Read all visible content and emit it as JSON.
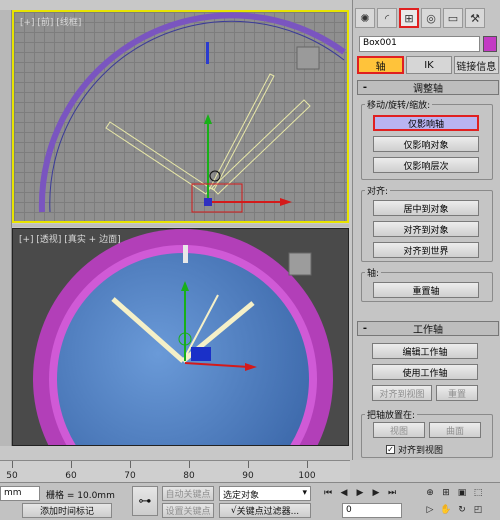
{
  "viewports": {
    "front_label": "[+] [前] [线框]",
    "persp_label": "[+] [透视] [真实 + 边面]"
  },
  "panel": {
    "tab_icons": [
      "sun-icon",
      "curve-icon",
      "hierarchy-icon",
      "motion-icon",
      "display-icon",
      "hammer-icon"
    ],
    "object_name": "Box001",
    "object_color": "#c33bc4",
    "subtabs": {
      "pivot": "轴",
      "ik": "IK",
      "link": "链接信息"
    },
    "adjust_pivot": {
      "title": "调整轴",
      "move_group": "移动/旋转/缩放:",
      "affect_pivot_only": "仅影响轴",
      "affect_object_only": "仅影响对象",
      "affect_hierarchy_only": "仅影响层次",
      "align_group": "对齐:",
      "center_to_object": "居中到对象",
      "align_to_object": "对齐到对象",
      "align_to_world": "对齐到世界",
      "pivot_group": "轴:",
      "reset_pivot": "重置轴"
    },
    "working_pivot": {
      "title": "工作轴",
      "edit": "编辑工作轴",
      "use": "使用工作轴",
      "align_to_view": "对齐到视图",
      "reset": "重置",
      "place_group": "把轴放置在:",
      "view": "视图",
      "surface": "曲面",
      "align_to_view_check": "对齐到视图",
      "check_mark": "✓"
    }
  },
  "ruler": {
    "labels": [
      "50",
      "60",
      "70",
      "80",
      "90",
      "100"
    ]
  },
  "statusbar": {
    "unit_field": "mm",
    "grid": "栅格 = 10.0mm",
    "auto_key": "自动关键点",
    "set_key": "设置关键点",
    "selected": "选定对象",
    "key_filters": "关键点过滤器...",
    "add_time_tag": "添加时间标记",
    "frame": "0",
    "key_icon": "⊶",
    "filter_icon": "√"
  },
  "colors": {
    "active_viewport_border": "#e8e400",
    "highlight": "#e02020",
    "active_tab": "#ffc33a",
    "active_button": "#b9b4f0"
  }
}
